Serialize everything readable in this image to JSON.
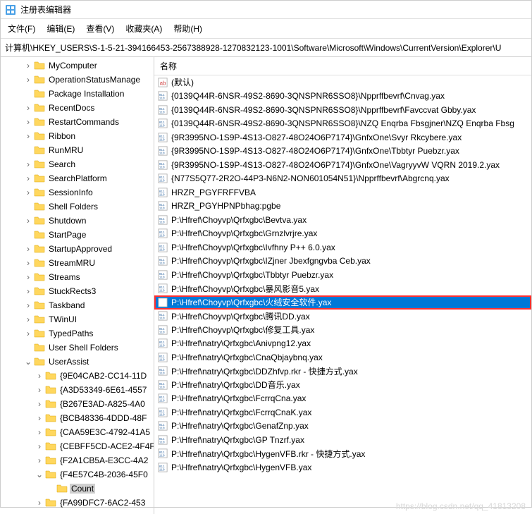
{
  "app": {
    "title": "注册表编辑器",
    "address": "计算机\\HKEY_USERS\\S-1-5-21-394166453-2567388928-1270832123-1001\\Software\\Microsoft\\Windows\\CurrentVersion\\Explorer\\U"
  },
  "menu": [
    "文件(F)",
    "编辑(E)",
    "查看(V)",
    "收藏夹(A)",
    "帮助(H)"
  ],
  "list": {
    "header": "名称",
    "rows": [
      {
        "type": "sz",
        "name": "(默认)"
      },
      {
        "type": "bin",
        "name": "{0139Q44R-6NSR-49S2-8690-3QNSPNR6SSO8}\\Npprffbevrf\\Cnvag.yax"
      },
      {
        "type": "bin",
        "name": "{0139Q44R-6NSR-49S2-8690-3QNSPNR6SSO8}\\Npprffbevrf\\Favccvat Gbby.yax"
      },
      {
        "type": "bin",
        "name": "{0139Q44R-6NSR-49S2-8690-3QNSPNR6SSO8}\\NZQ Enqrba Fbsgjner\\NZQ Enqrba Fbsg"
      },
      {
        "type": "bin",
        "name": "{9R3995NO-1S9P-4S13-O827-48O24O6P7174}\\GnfxOne\\Svyr Rkcybere.yax"
      },
      {
        "type": "bin",
        "name": "{9R3995NO-1S9P-4S13-O827-48O24O6P7174}\\GnfxOne\\Tbbtyr Puebzr.yax"
      },
      {
        "type": "bin",
        "name": "{9R3995NO-1S9P-4S13-O827-48O24O6P7174}\\GnfxOne\\VagryyvW VQRN 2019.2.yax"
      },
      {
        "type": "bin",
        "name": "{N77S5Q77-2R2O-44P3-N6N2-NON601054N51}\\Npprffbevrf\\Abgrcnq.yax"
      },
      {
        "type": "bin",
        "name": "HRZR_PGYFRFFVBA"
      },
      {
        "type": "bin",
        "name": "HRZR_PGYHPNPbhag:pgbe"
      },
      {
        "type": "bin",
        "name": "P:\\Hfref\\Choyvp\\Qrfxgbc\\Bevtva.yax"
      },
      {
        "type": "bin",
        "name": "P:\\Hfref\\Choyvp\\Qrfxgbc\\Grnzlvrjre.yax"
      },
      {
        "type": "bin",
        "name": "P:\\Hfref\\Choyvp\\Qrfxgbc\\Ivfhny P++ 6.0.yax"
      },
      {
        "type": "bin",
        "name": "P:\\Hfref\\Choyvp\\Qrfxgbc\\IZjner Jbexfgngvba Ceb.yax"
      },
      {
        "type": "bin",
        "name": "P:\\Hfref\\Choyvp\\Qrfxgbc\\Tbbtyr Puebzr.yax"
      },
      {
        "type": "bin",
        "name": "P:\\Hfref\\Choyvp\\Qrfxgbc\\暴风影音5.yax"
      },
      {
        "type": "bin",
        "name": "P:\\Hfref\\Choyvp\\Qrfxgbc\\火绒安全软件.yax",
        "selected": true,
        "highlighted": true
      },
      {
        "type": "bin",
        "name": "P:\\Hfref\\Choyvp\\Qrfxgbc\\腾讯DD.yax"
      },
      {
        "type": "bin",
        "name": "P:\\Hfref\\Choyvp\\Qrfxgbc\\修复工具.yax"
      },
      {
        "type": "bin",
        "name": "P:\\Hfref\\natry\\Qrfxgbc\\Anivpng12.yax"
      },
      {
        "type": "bin",
        "name": "P:\\Hfref\\natry\\Qrfxgbc\\CnaQbjaybnq.yax"
      },
      {
        "type": "bin",
        "name": "P:\\Hfref\\natry\\Qrfxgbc\\DDZhfvp.rkr - 快捷方式.yax"
      },
      {
        "type": "bin",
        "name": "P:\\Hfref\\natry\\Qrfxgbc\\DD音乐.yax"
      },
      {
        "type": "bin",
        "name": "P:\\Hfref\\natry\\Qrfxgbc\\FcrrqCna.yax"
      },
      {
        "type": "bin",
        "name": "P:\\Hfref\\natry\\Qrfxgbc\\FcrrqCnaK.yax"
      },
      {
        "type": "bin",
        "name": "P:\\Hfref\\natry\\Qrfxgbc\\GenafZnp.yax"
      },
      {
        "type": "bin",
        "name": "P:\\Hfref\\natry\\Qrfxgbc\\GP Tnzrf.yax"
      },
      {
        "type": "bin",
        "name": "P:\\Hfref\\natry\\Qrfxgbc\\HygenVFB.rkr - 快捷方式.yax"
      },
      {
        "type": "bin",
        "name": "P:\\Hfref\\natry\\Qrfxgbc\\HygenVFB.yax"
      }
    ]
  },
  "tree": [
    {
      "indent": 2,
      "twisty": ">",
      "label": "MyComputer"
    },
    {
      "indent": 2,
      "twisty": ">",
      "label": "OperationStatusManage"
    },
    {
      "indent": 2,
      "twisty": "",
      "label": "Package Installation"
    },
    {
      "indent": 2,
      "twisty": ">",
      "label": "RecentDocs"
    },
    {
      "indent": 2,
      "twisty": ">",
      "label": "RestartCommands"
    },
    {
      "indent": 2,
      "twisty": ">",
      "label": "Ribbon"
    },
    {
      "indent": 2,
      "twisty": "",
      "label": "RunMRU"
    },
    {
      "indent": 2,
      "twisty": ">",
      "label": "Search"
    },
    {
      "indent": 2,
      "twisty": ">",
      "label": "SearchPlatform"
    },
    {
      "indent": 2,
      "twisty": ">",
      "label": "SessionInfo"
    },
    {
      "indent": 2,
      "twisty": "",
      "label": "Shell Folders"
    },
    {
      "indent": 2,
      "twisty": ">",
      "label": "Shutdown"
    },
    {
      "indent": 2,
      "twisty": "",
      "label": "StartPage"
    },
    {
      "indent": 2,
      "twisty": ">",
      "label": "StartupApproved"
    },
    {
      "indent": 2,
      "twisty": ">",
      "label": "StreamMRU"
    },
    {
      "indent": 2,
      "twisty": ">",
      "label": "Streams"
    },
    {
      "indent": 2,
      "twisty": ">",
      "label": "StuckRects3"
    },
    {
      "indent": 2,
      "twisty": ">",
      "label": "Taskband"
    },
    {
      "indent": 2,
      "twisty": ">",
      "label": "TWinUI"
    },
    {
      "indent": 2,
      "twisty": ">",
      "label": "TypedPaths"
    },
    {
      "indent": 2,
      "twisty": "",
      "label": "User Shell Folders"
    },
    {
      "indent": 2,
      "twisty": "v",
      "label": "UserAssist"
    },
    {
      "indent": 3,
      "twisty": ">",
      "label": "{9E04CAB2-CC14-11D"
    },
    {
      "indent": 3,
      "twisty": ">",
      "label": "{A3D53349-6E61-4557"
    },
    {
      "indent": 3,
      "twisty": ">",
      "label": "{B267E3AD-A825-4A0"
    },
    {
      "indent": 3,
      "twisty": ">",
      "label": "{BCB48336-4DDD-48F"
    },
    {
      "indent": 3,
      "twisty": ">",
      "label": "{CAA59E3C-4792-41A5"
    },
    {
      "indent": 3,
      "twisty": ">",
      "label": "{CEBFF5CD-ACE2-4F4F"
    },
    {
      "indent": 3,
      "twisty": ">",
      "label": "{F2A1CB5A-E3CC-4A2"
    },
    {
      "indent": 3,
      "twisty": "v",
      "label": "{F4E57C4B-2036-45F0"
    },
    {
      "indent": 4,
      "twisty": "",
      "label": "Count",
      "selected": true
    },
    {
      "indent": 3,
      "twisty": ">",
      "label": "{FA99DFC7-6AC2-453"
    }
  ],
  "watermark": "https://blog.csdn.net/qq_41813208"
}
